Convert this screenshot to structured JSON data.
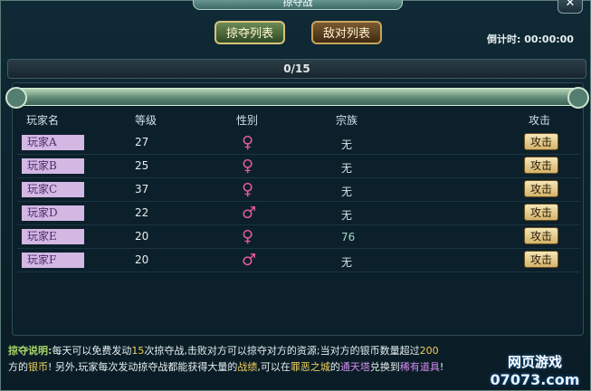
{
  "window": {
    "title": "掠夺战",
    "close_glyph": "✕"
  },
  "tabs": [
    {
      "label": "掠夺列表"
    },
    {
      "label": "敌对列表"
    }
  ],
  "timer": {
    "text": "倒计时: 00:00:00"
  },
  "count": {
    "text": "0/15"
  },
  "table": {
    "headers": [
      "玩家名",
      "等级",
      "性别",
      "宗族",
      "攻击"
    ],
    "rows": [
      {
        "name": "玩家A",
        "level": "27",
        "gender": "♀",
        "clan": "无",
        "attack": "攻击"
      },
      {
        "name": "玩家B",
        "level": "25",
        "gender": "♀",
        "clan": "无",
        "attack": "攻击"
      },
      {
        "name": "玩家C",
        "level": "37",
        "gender": "♀",
        "clan": "无",
        "attack": "攻击"
      },
      {
        "name": "玩家D",
        "level": "22",
        "gender": "♂",
        "clan": "无",
        "attack": "攻击"
      },
      {
        "name": "玩家E",
        "level": "20",
        "gender": "♀",
        "clan": "76",
        "attack": "攻击"
      },
      {
        "name": "玩家F",
        "level": "20",
        "gender": "♂",
        "clan": "无",
        "attack": "攻击"
      }
    ]
  },
  "description": {
    "label": "掠夺说明:",
    "t1": "每天可以免费发动",
    "n15": "15",
    "t2": "次掠夺战,击败对方可以掠夺对方的资源;当对方的银币数量超过",
    "n200": "200",
    "t3": "方的",
    "silver": "银币",
    "t4": "! 另外,玩家每次发动掠夺战都能获得大量的",
    "feat": "战绩",
    "t5": ",可以在",
    "city": "罪恶之城",
    "t6": "的",
    "tower": "通天塔",
    "t7": "兑换到",
    "item": "稀有道具",
    "t8": "!"
  },
  "watermark": {
    "line1": "网页游戏",
    "line2": "07073.com"
  }
}
